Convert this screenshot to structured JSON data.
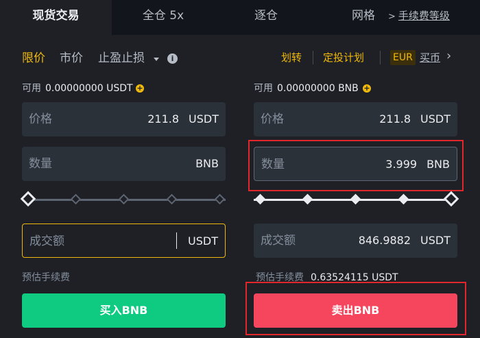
{
  "tabs": [
    {
      "label": "现货交易",
      "active": true
    },
    {
      "label": "全仓 5x",
      "active": false
    },
    {
      "label": "逐仓",
      "active": false
    },
    {
      "label": "网格",
      "active": false
    }
  ],
  "fee_level_link": {
    "chevron": ">",
    "label": "手续费等级"
  },
  "order_types": {
    "limit": "限价",
    "market": "市价",
    "stop": "止盈止损",
    "info": "i"
  },
  "right_links": {
    "transfer": "划转",
    "dca": "定投计划",
    "fiat_badge": "EUR",
    "buy_coin": "买币",
    "chevron": "›"
  },
  "buy": {
    "available_label": "可用",
    "available_value": "0.00000000 USDT",
    "price": {
      "label": "价格",
      "value": "211.8",
      "unit": "USDT"
    },
    "amount": {
      "label": "数量",
      "value": "",
      "unit": "BNB"
    },
    "slider_level": 0,
    "total": {
      "label": "成交额",
      "value": "",
      "unit": "USDT"
    },
    "fee_label": "预估手续费",
    "button": "买入BNB"
  },
  "sell": {
    "available_label": "可用",
    "available_value": "0.00000000 BNB",
    "price": {
      "label": "价格",
      "value": "211.8",
      "unit": "USDT"
    },
    "amount": {
      "label": "数量",
      "value": "3.999",
      "unit": "BNB"
    },
    "slider_level": 1.0,
    "total": {
      "label": "成交额",
      "value": "846.9882",
      "unit": "USDT"
    },
    "fee_label": "预估手续费",
    "fee_value": "0.63524115 USDT",
    "button": "卖出BNB"
  },
  "colors": {
    "accent": "#f0b90b",
    "buy": "#0ecb81",
    "sell": "#f6465d",
    "annotation": "#e3262b"
  },
  "icons": [
    "info-icon",
    "plus-circle-icon",
    "chevron-right-icon",
    "dropdown-caret-icon"
  ]
}
